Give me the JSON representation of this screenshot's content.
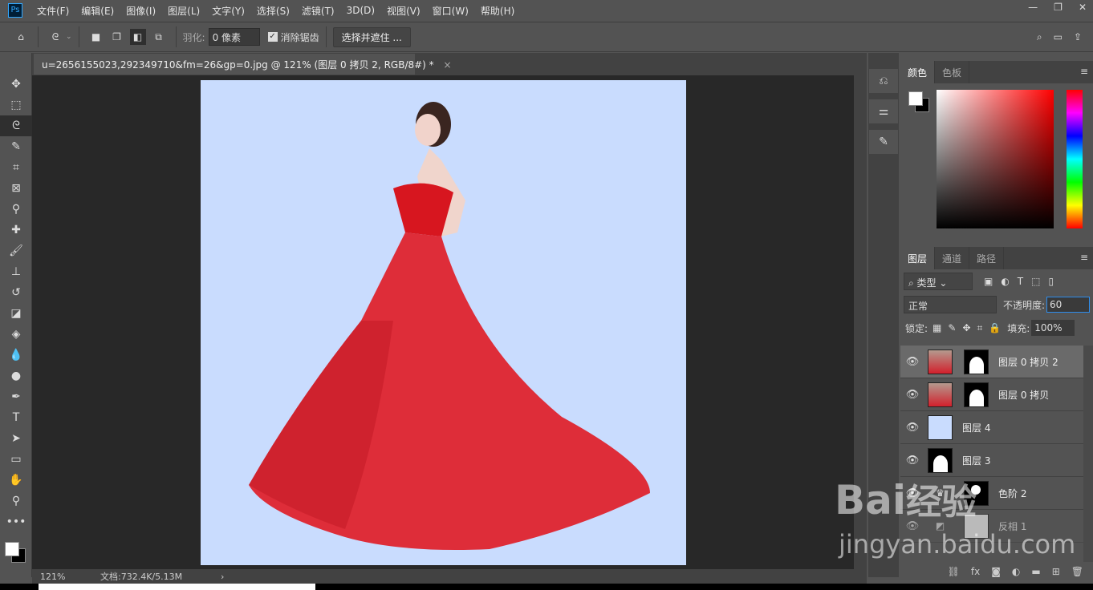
{
  "app": {
    "logo": "Ps"
  },
  "menu": [
    "文件(F)",
    "编辑(E)",
    "图像(I)",
    "图层(L)",
    "文字(Y)",
    "选择(S)",
    "滤镜(T)",
    "3D(D)",
    "视图(V)",
    "窗口(W)",
    "帮助(H)"
  ],
  "window_controls": {
    "minimize": "—",
    "restore": "❐",
    "close": "✕"
  },
  "options": {
    "feather_label": "羽化:",
    "feather_value": "0 像素",
    "antialias_label": "消除锯齿",
    "antialias_checked": true,
    "select_mask": "选择并遮住 ..."
  },
  "document": {
    "tab_title": "u=2656155023,292349710&fm=26&gp=0.jpg @ 121% (图层 0 拷贝 2, RGB/8#) *",
    "close": "×",
    "zoom": "121%",
    "doc_info": "文档:732.4K/5.13M",
    "arrow": "›",
    "canvas_color": "#c9dcfe"
  },
  "color_panel": {
    "tabs": [
      "颜色",
      "色板"
    ],
    "foreground": "#ffffff",
    "background": "#000000"
  },
  "layers_panel": {
    "tabs": [
      "图层",
      "通道",
      "路径"
    ],
    "filter_label": "类型",
    "blend_mode": "正常",
    "opacity_label": "不透明度:",
    "opacity_value": "60",
    "lock_label": "锁定:",
    "fill_label": "填充:",
    "fill_value": "100%",
    "layers": [
      {
        "name": "图层 0 拷贝 2",
        "selected": true,
        "type": "photo-mask"
      },
      {
        "name": "图层 0 拷贝",
        "selected": false,
        "type": "photo-mask"
      },
      {
        "name": "图层 4",
        "selected": false,
        "type": "solid"
      },
      {
        "name": "图层 3",
        "selected": false,
        "type": "silhouette"
      },
      {
        "name": "色阶 2",
        "selected": false,
        "type": "adjustment"
      },
      {
        "name": "反相 1",
        "selected": false,
        "type": "adjustment"
      }
    ]
  },
  "watermark": {
    "text": "Bai经验",
    "url": "jingyan.baidu.com"
  }
}
